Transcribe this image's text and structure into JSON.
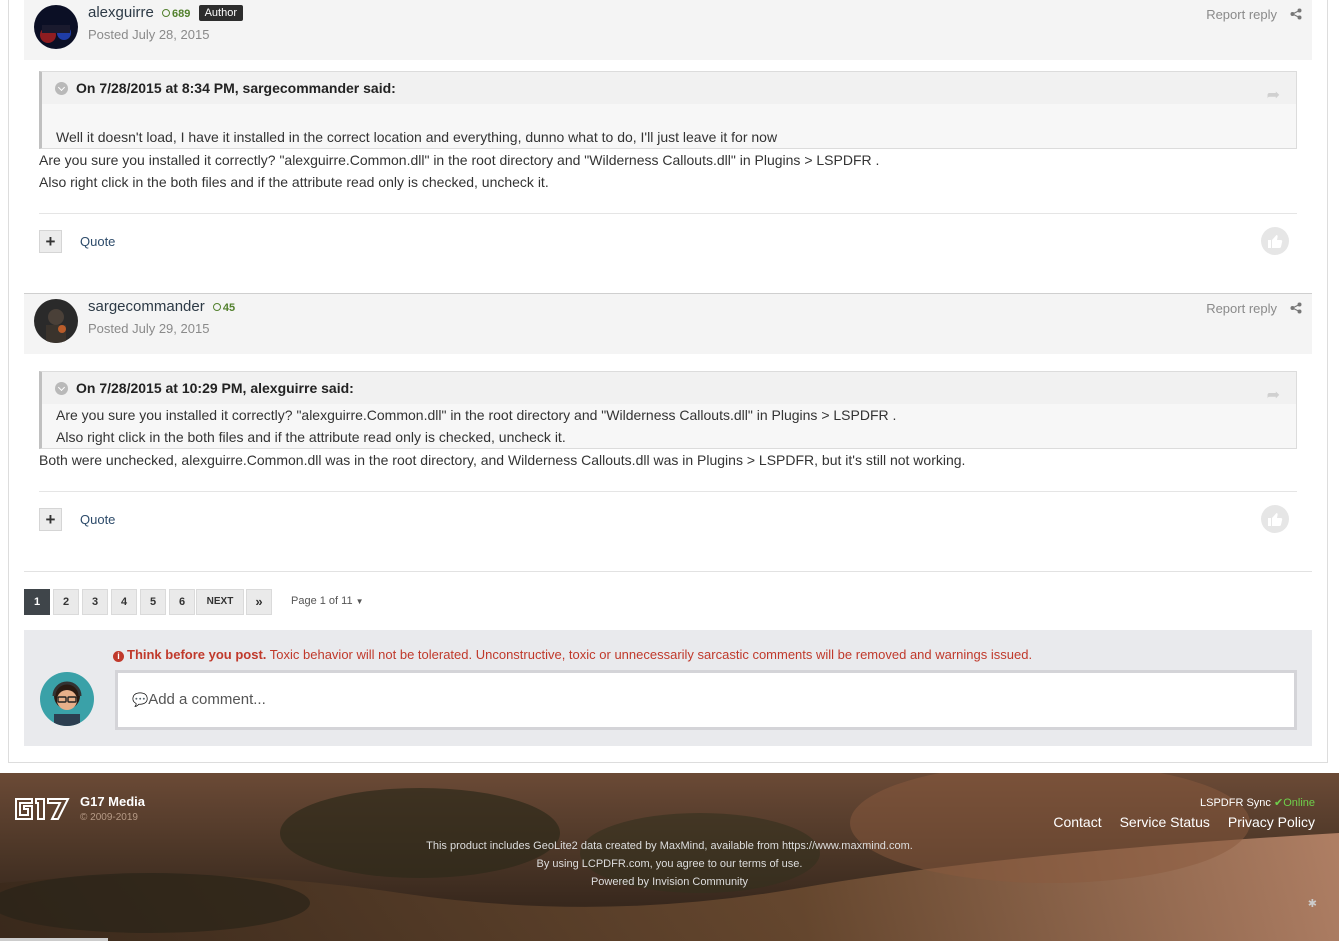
{
  "posts": [
    {
      "author": "alexguirre",
      "reputation": "689",
      "badge": "Author",
      "posted": "Posted July 28, 2015",
      "report": "Report reply",
      "quote_header": "On 7/28/2015 at 8:34 PM, sargecommander said:",
      "quote_lines": [
        "Well it doesn't load, I have it installed in the correct location and everything, dunno what to do, I'll just leave it for now"
      ],
      "body_lines": [
        "Are you sure you installed it correctly? \"alexguirre.Common.dll\" in the root directory and \"Wilderness Callouts.dll\" in Plugins > LSPDFR .",
        "Also right click in the both files and if the attribute read only is checked, uncheck it."
      ],
      "quote_label": "Quote"
    },
    {
      "author": "sargecommander",
      "reputation": "45",
      "posted": "Posted July 29, 2015",
      "report": "Report reply",
      "quote_header": "On 7/28/2015 at 10:29 PM, alexguirre said:",
      "quote_lines": [
        "Are you sure you installed it correctly? \"alexguirre.Common.dll\" in the root directory and \"Wilderness Callouts.dll\" in Plugins > LSPDFR .",
        "Also right click in the both files and if the attribute read only is checked, uncheck it."
      ],
      "body_lines": [
        "Both were unchecked, alexguirre.Common.dll was in the root directory, and Wilderness Callouts.dll was in Plugins > LSPDFR, but it's still not working."
      ],
      "quote_label": "Quote"
    }
  ],
  "pagination": {
    "pages": [
      "1",
      "2",
      "3",
      "4",
      "5",
      "6"
    ],
    "active": "1",
    "next": "NEXT",
    "last": "»",
    "page_of": "Page 1 of 11"
  },
  "reply": {
    "warning_bold": "Think before you post.",
    "warning_text": " Toxic behavior will not be tolerated. Unconstructive, toxic or unnecessarily sarcastic comments will be removed and warnings issued.",
    "placeholder": "Add a comment..."
  },
  "footer": {
    "brand": "G17 Media",
    "copyright": "© 2009-2019",
    "line1": "This product includes GeoLite2 data created by MaxMind, available from https://www.maxmind.com.",
    "line2": "By using LCPDFR.com, you agree to our terms of use.",
    "line3": "Powered by Invision Community",
    "sync_label": "LSPDFR Sync",
    "sync_status": "Online",
    "links": [
      "Contact",
      "Service Status",
      "Privacy Policy"
    ]
  },
  "colors": {
    "accent_text": "#2d4b6a",
    "reputation": "#52802d",
    "warning": "#c0392b",
    "online": "#6fd04b"
  }
}
